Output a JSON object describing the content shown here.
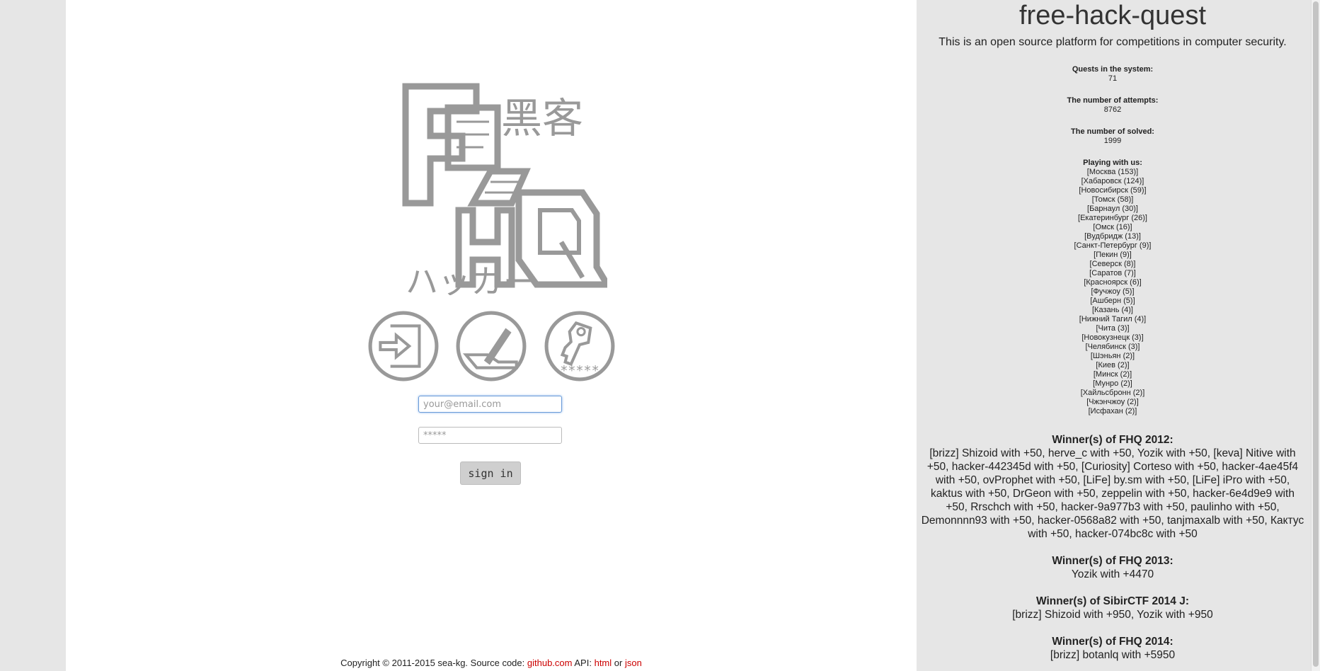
{
  "site": {
    "title": "free-hack-quest",
    "description": "This is an open source platform for competitions in computer security."
  },
  "logo": {
    "kanji": "黑客",
    "katakana": "ハッカー",
    "letters": "FHQ"
  },
  "actions": [
    {
      "name": "login",
      "icon": "login-icon"
    },
    {
      "name": "register",
      "icon": "register-icon"
    },
    {
      "name": "restore",
      "icon": "key-icon",
      "label": "*****"
    }
  ],
  "form": {
    "email_placeholder": "your@email.com",
    "password_placeholder": "*****",
    "signin_label": "sign in"
  },
  "footer": {
    "copyright": "Copyright © 2011-2015 sea-kg. Source code:",
    "github_link": "github.com",
    "api_label": "API:",
    "html_link": "html",
    "or": "or",
    "json_link": "json"
  },
  "stats": {
    "quests_label": "Quests in the system:",
    "quests_value": "71",
    "attempts_label": "The number of attempts:",
    "attempts_value": "8762",
    "solved_label": "The number of solved:",
    "solved_value": "1999",
    "playing_label": "Playing with us:"
  },
  "cities": [
    "[Москва (153)]",
    "[Хабаровск (124)]",
    "[Новосибирск (59)]",
    "[Томск (58)]",
    "[Барнаул (30)]",
    "[Екатеринбург (26)]",
    "[Омск (16)]",
    "[Вудбридж (13)]",
    "[Санкт-Петербург (9)]",
    "[Пекин (9)]",
    "[Северск (8)]",
    "[Саратов (7)]",
    "[Красноярск (6)]",
    "[Фучжоу (5)]",
    "[Ашберн (5)]",
    "[Казань (4)]",
    "[Нижний Тагил (4)]",
    "[Чита (3)]",
    "[Новокузнецк (3)]",
    "[Челябинск (3)]",
    "[Шэньян (2)]",
    "[Киев (2)]",
    "[Минск (2)]",
    "[Мунро (2)]",
    "[Хайльсбронн (2)]",
    "[Чжэнчжоу (2)]",
    "[Исфахан (2)]"
  ],
  "winners": [
    {
      "title": "Winner(s) of FHQ 2012:",
      "text": "[brizz] Shizoid with +50, herve_c with +50, Yozik with +50, [keva] Nitive with +50, hacker-442345d with +50, [Curiosity] Corteso with +50, hacker-4ae45f4 with +50, ovProphet with +50, [LiFe] by.sm with +50, [LiFe] iPro with +50, kaktus with +50, DrGeon with +50, zeppelin with +50, hacker-6e4d9e9 with +50, Rrschch with +50, hacker-9a977b3 with +50, paulinho with +50, Demonnnn93 with +50, hacker-0568a82 with +50, tanjmaxalb with +50, Кактус with +50, hacker-074bc8c with +50"
    },
    {
      "title": "Winner(s) of FHQ 2013:",
      "text": "Yozik with +4470"
    },
    {
      "title": "Winner(s) of SibirCTF 2014 J:",
      "text": "[brizz] Shizoid with +950, Yozik with +950"
    },
    {
      "title": "Winner(s) of FHQ 2014:",
      "text": "[brizz] botanlq with +5950"
    }
  ],
  "colors": {
    "logo_gray": "#999999",
    "link_red": "#cc0000",
    "sidebar_bg": "#e6e6e6"
  }
}
